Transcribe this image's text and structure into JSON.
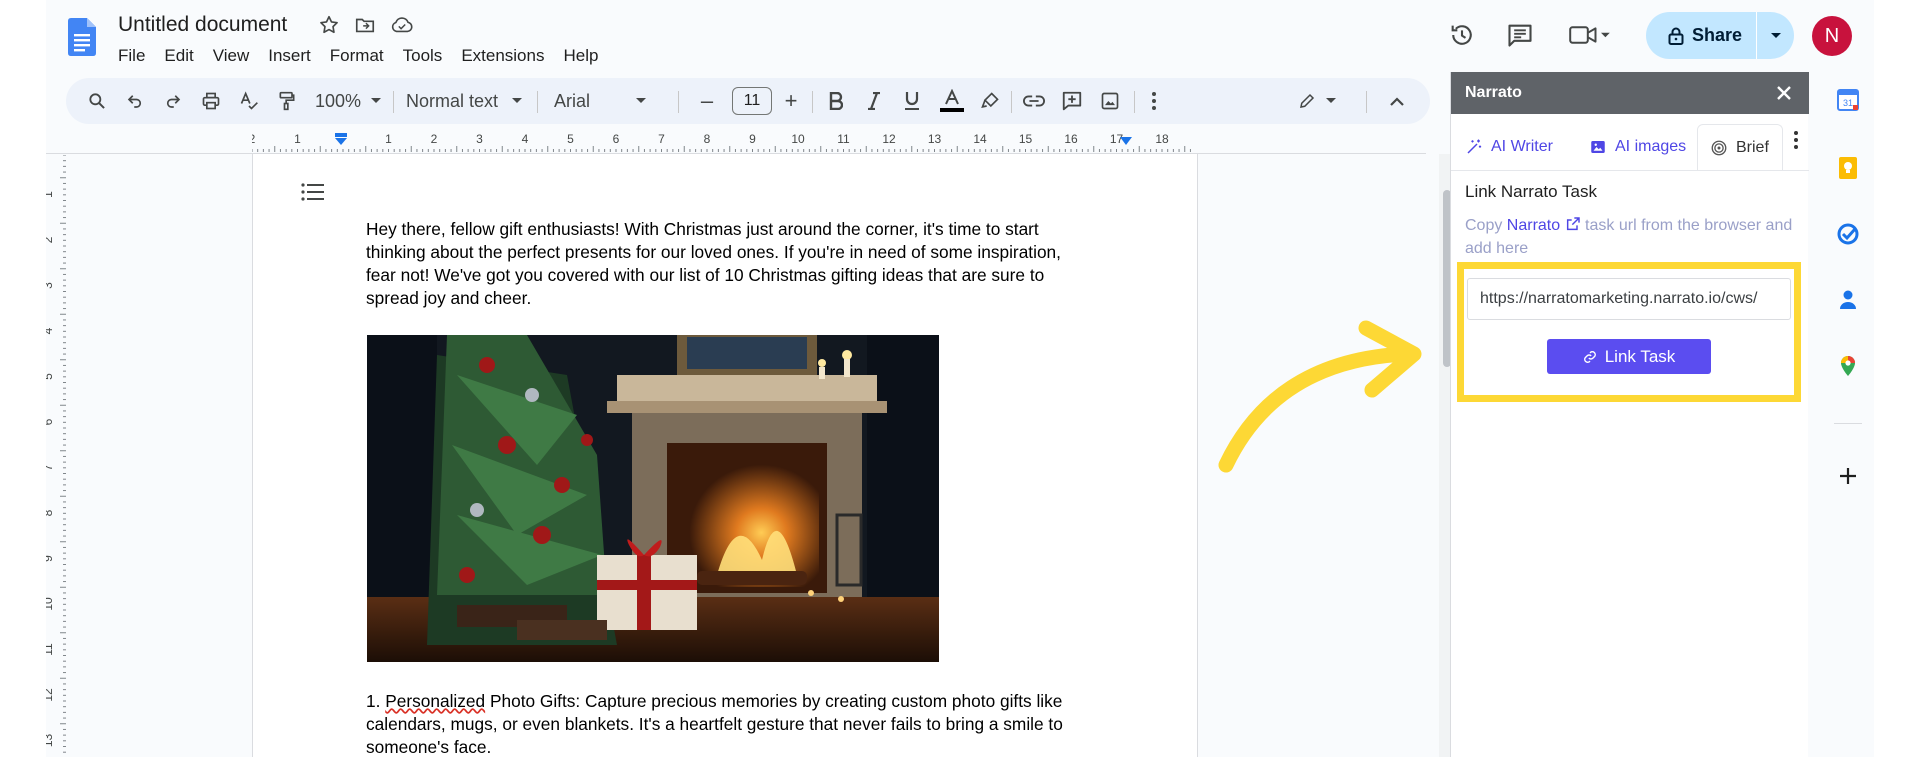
{
  "document": {
    "title": "Untitled document",
    "menu": [
      "File",
      "Edit",
      "View",
      "Insert",
      "Format",
      "Tools",
      "Extensions",
      "Help"
    ]
  },
  "header": {
    "share_label": "Share",
    "avatar_initial": "N",
    "icons": [
      "history-icon",
      "comment-icon",
      "meet-icon",
      "share-caret-icon"
    ]
  },
  "toolbar": {
    "zoom": "100%",
    "style": "Normal text",
    "font": "Arial",
    "font_size": "11",
    "minus": "–",
    "plus": "+"
  },
  "ruler": {
    "horizontal_ticks": [
      "2",
      "1",
      "1",
      "2",
      "3",
      "4",
      "5",
      "6",
      "7",
      "8",
      "9",
      "10",
      "11",
      "12",
      "13",
      "14",
      "15",
      "16",
      "17",
      "18"
    ],
    "vertical_ticks": [
      "1",
      "2",
      "3",
      "4",
      "5",
      "6",
      "7",
      "8",
      "9",
      "10",
      "11",
      "12",
      "13"
    ]
  },
  "body": {
    "intro": "Hey there, fellow gift enthusiasts! With Christmas just around the corner, it's time to start thinking about the perfect presents for our loved ones. If you're in need of some inspiration, fear not! We've got you covered with our list of 10 Christmas gifting ideas that are sure to spread joy and cheer.",
    "item1_prefix": "1. ",
    "item1_word": "Personalized",
    "item1_rest": " Photo Gifts: Capture precious memories by creating custom photo gifts like calendars, mugs, or even blankets. It's a heartfelt gesture that never fails to bring a smile to someone's face."
  },
  "sidebar": {
    "title": "Narrato",
    "tabs": [
      {
        "label": "AI Writer",
        "icon": "magic-wand-icon"
      },
      {
        "label": "AI images",
        "icon": "image-icon"
      },
      {
        "label": "Brief",
        "icon": "target-icon",
        "active": true
      }
    ],
    "section_title": "Link Narrato Task",
    "desc_before": "Copy ",
    "desc_link": "Narrato",
    "desc_after": " task url from the browser and add here",
    "url_value": "https://narratomarketing.narrato.io/cws/",
    "button_label": "Link Task",
    "highlight_color": "#fdd835"
  },
  "rail": {
    "icons": [
      "calendar-icon",
      "keep-icon",
      "tasks-icon",
      "contacts-icon",
      "maps-icon",
      "add-icon"
    ],
    "calendar_day": "31"
  },
  "colors": {
    "accent": "#5b4df0",
    "share_bg": "#c2e7ff",
    "avatar_bg": "#c8123d",
    "arrow": "#fdd835"
  }
}
